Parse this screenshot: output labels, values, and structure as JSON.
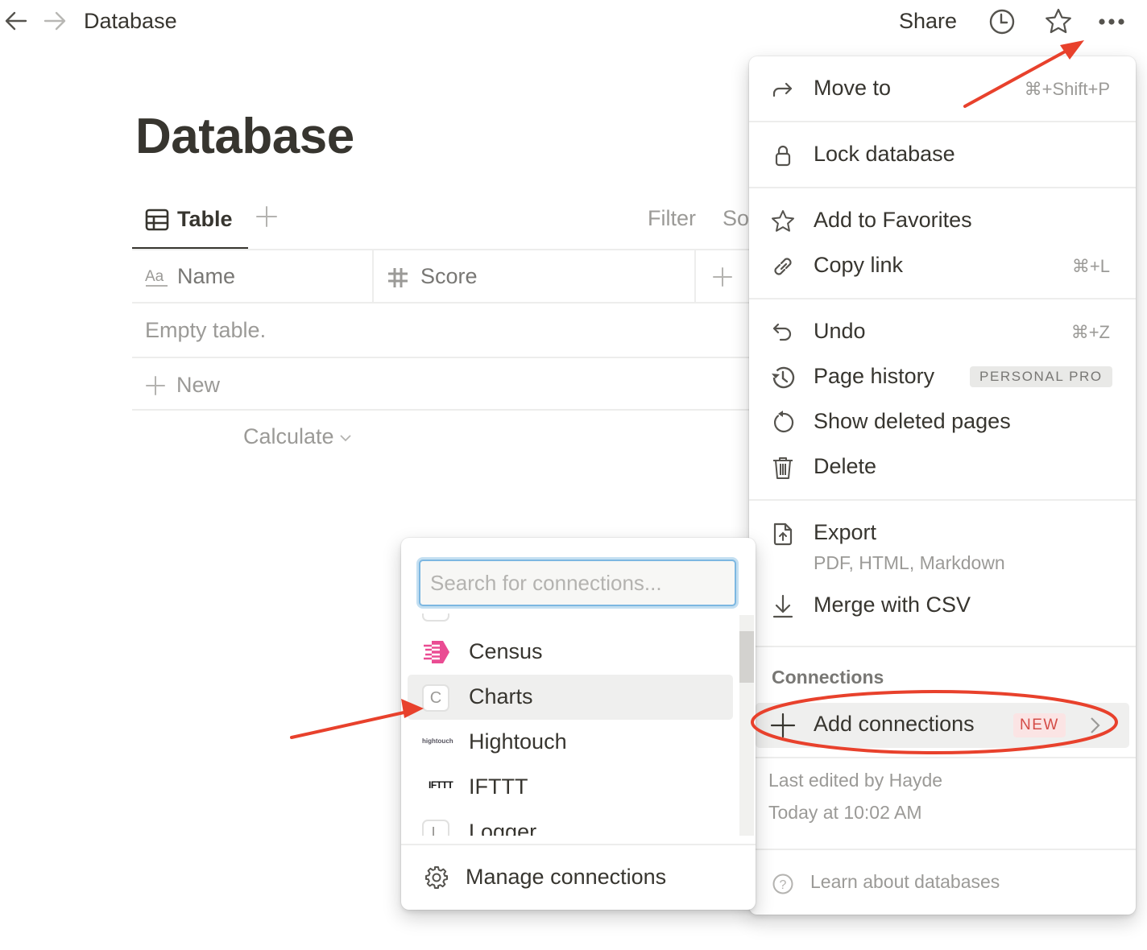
{
  "topbar": {
    "back_icon": "arrow-left-icon",
    "forward_icon": "arrow-right-icon",
    "breadcrumb": "Database",
    "share_label": "Share",
    "updates_icon": "clock-icon",
    "favorite_icon": "star-icon",
    "more_icon": "more-horizontal-icon"
  },
  "page": {
    "title": "Database",
    "views": [
      {
        "label": "Table",
        "icon": "table-icon",
        "active": true
      }
    ],
    "add_view_icon": "plus-icon",
    "filter_label": "Filter",
    "sort_label": "Sort",
    "table": {
      "columns": [
        {
          "label": "Name",
          "icon": "text-aa-icon"
        },
        {
          "label": "Score",
          "icon": "hash-icon"
        }
      ],
      "add_column_icon": "plus-icon",
      "empty_text": "Empty table.",
      "new_label": "New",
      "calculate_label": "Calculate"
    }
  },
  "menu": {
    "items": [
      {
        "label": "Move to",
        "icon": "arrow-turn-right-icon",
        "shortcut": "⌘+Shift+P"
      },
      {
        "label": "Lock database",
        "icon": "lock-icon"
      },
      {
        "label": "Add to Favorites",
        "icon": "star-icon"
      },
      {
        "label": "Copy link",
        "icon": "link-icon",
        "shortcut": "⌘+L"
      },
      {
        "label": "Undo",
        "icon": "undo-icon",
        "shortcut": "⌘+Z"
      },
      {
        "label": "Page history",
        "icon": "history-icon",
        "badge": "PERSONAL PRO"
      },
      {
        "label": "Show deleted pages",
        "icon": "restore-icon"
      },
      {
        "label": "Delete",
        "icon": "trash-icon"
      },
      {
        "label": "Export",
        "icon": "file-export-icon",
        "sublabel": "PDF, HTML, Markdown"
      },
      {
        "label": "Merge with CSV",
        "icon": "download-icon"
      }
    ],
    "connections_heading": "Connections",
    "add_connections": {
      "label": "Add connections",
      "badge": "NEW",
      "icon": "plus-icon"
    },
    "last_edited_by": "Last edited by Hayde",
    "last_edited_time": "Today at 10:02 AM",
    "learn_label": "Learn about databases"
  },
  "connections_popup": {
    "search_placeholder": "Search for connections...",
    "search_value": "",
    "items": [
      {
        "label": "Census",
        "logo": "census-logo"
      },
      {
        "label": "Charts",
        "logo": "letter-c-logo",
        "logo_text": "C",
        "highlighted": true
      },
      {
        "label": "Hightouch",
        "logo": "hightouch-logo",
        "logo_text": "hightouch"
      },
      {
        "label": "IFTTT",
        "logo": "ifttt-logo",
        "logo_text": "IFTTT"
      },
      {
        "label": "Logger",
        "logo": "letter-l-logo",
        "logo_text": "L"
      }
    ],
    "manage_label": "Manage connections"
  },
  "annotations": {
    "color": "#e8412c"
  }
}
